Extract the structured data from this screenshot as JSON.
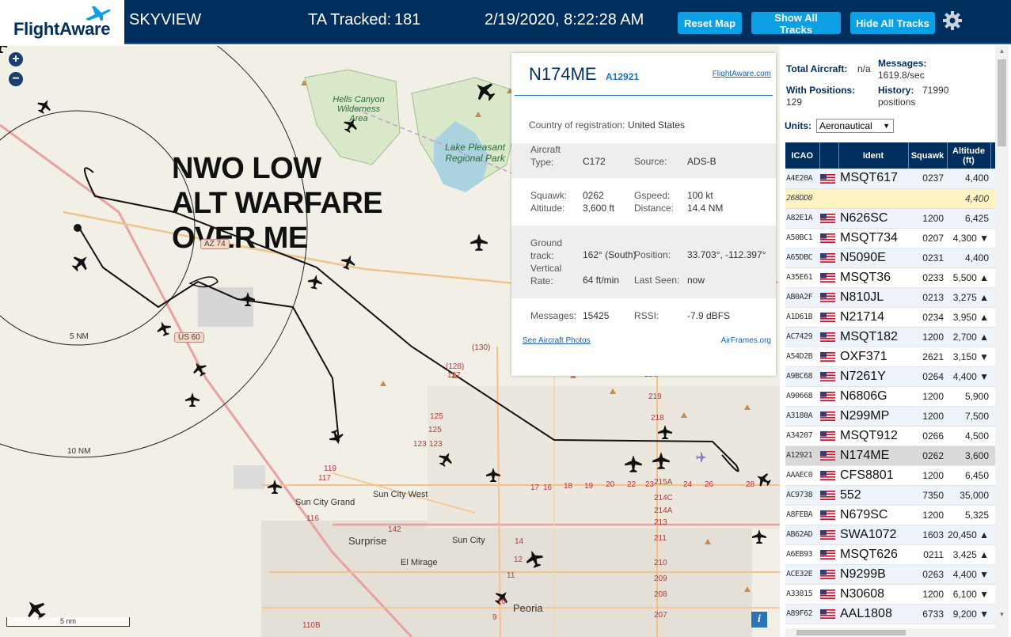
{
  "header": {
    "logo_text": "FlightAware",
    "app_title": "SKYVIEW",
    "ta_tracked_label": "TA Tracked:",
    "ta_tracked_count": "181",
    "datetime": "2/19/2020, 8:22:28 AM",
    "buttons": {
      "reset_map": "Reset Map",
      "show_all_tracks": "Show All Tracks",
      "hide_all_tracks": "Hide All Tracks"
    },
    "settings_icon": "gear-icon",
    "colors": {
      "bar": "#002f5d",
      "button": "#0d9fe3"
    }
  },
  "map": {
    "overlay_text": [
      "NWO LOW",
      "ALT WARFARE",
      "OVER ME"
    ],
    "zoom_in": "+",
    "zoom_out": "−",
    "scale_label": "5 nm",
    "range_rings": [
      "5 NM",
      "10 NM"
    ],
    "places": {
      "hells_canyon": "Hells Canyon Wilderness Area",
      "lake_pleasant": "Lake Pleasant Regional Park",
      "sun_city_grand": "Sun City Grand",
      "sun_city_west": "Sun City West",
      "surprise": "Surprise",
      "sun_city": "Sun City",
      "el_mirage": "El Mirage",
      "peoria": "Peoria"
    },
    "shields": {
      "az74": "AZ 74",
      "us60": "US 60"
    },
    "route_numbers": {
      "r130": "(130)",
      "r128": "(128)",
      "r127": "127",
      "r125": "125",
      "r125b": "125",
      "r123": "123",
      "r123b": "123",
      "r119": "119",
      "r117": "117",
      "r116": "116",
      "r142": "142",
      "r14": "14",
      "r12": "12",
      "r11": "11",
      "r10": "10",
      "r9": "9",
      "r110b": "110B",
      "r17": "17",
      "r16": "16",
      "r18": "18",
      "r19": "19",
      "r20": "20",
      "r22": "22",
      "r23": "23",
      "r24": "24",
      "r26": "26",
      "r28": "28",
      "r218": "218",
      "r219": "219",
      "r220": "220",
      "r215a": "215A",
      "r214c": "214C",
      "r214a": "214A",
      "r213": "213",
      "r211": "211",
      "r210": "210",
      "r209": "209",
      "r208": "208",
      "r207": "207"
    },
    "info_icon": "i"
  },
  "popup": {
    "callsign": "N174ME",
    "hex": "A12921",
    "fa_link": "FlightAware.com",
    "country_label": "Country of registration:",
    "country": "United States",
    "aircraft_type_label": "Aircraft Type:",
    "aircraft_type": "C172",
    "source_label": "Source:",
    "source": "ADS-B",
    "squawk_label": "Squawk:",
    "squawk": "0262",
    "gspeed_label": "Gspeed:",
    "gspeed": "100 kt",
    "altitude_label": "Altitude:",
    "altitude": "3,600 ft",
    "distance_label": "Distance:",
    "distance": "14.4 NM",
    "ground_track_label": "Ground track:",
    "ground_track": "162° (South)",
    "position_label": "Position:",
    "position": "33.703°, -112.397°",
    "vertical_rate_label": "Vertical Rate:",
    "vertical_rate": "64 ft/min",
    "last_seen_label": "Last Seen:",
    "last_seen": "now",
    "messages_label": "Messages:",
    "messages": "15425",
    "rssi_label": "RSSI:",
    "rssi": "-7.9 dBFS",
    "photos_link": "See Aircraft Photos",
    "airframes_link": "AirFrames.org"
  },
  "panel": {
    "total_aircraft_label": "Total Aircraft:",
    "total_aircraft": "n/a",
    "messages_label": "Messages:",
    "messages_rate": "1619.8/sec",
    "with_positions_label": "With Positions:",
    "with_positions": "129",
    "history_label": "History:",
    "history_value": "71990",
    "history_unit": "positions",
    "units_label": "Units:",
    "units_value": "Aeronautical",
    "columns": [
      "ICAO",
      "Ident",
      "Squawk",
      "Altitude (ft)"
    ],
    "rows": [
      {
        "icao": "A4E20A",
        "ident": "MSQT617",
        "squawk": "0237",
        "altitude": "4,400"
      },
      {
        "icao": "268DD0",
        "ident": "",
        "squawk": "",
        "altitude": "4,400"
      },
      {
        "icao": "A82E1A",
        "ident": "N626SC",
        "squawk": "1200",
        "altitude": "6,425"
      },
      {
        "icao": "A50BC1",
        "ident": "MSQT734",
        "squawk": "0207",
        "altitude": "4,300 ▼"
      },
      {
        "icao": "A65DBC",
        "ident": "N5090E",
        "squawk": "0231",
        "altitude": "4,400"
      },
      {
        "icao": "A35E61",
        "ident": "MSQT36",
        "squawk": "0233",
        "altitude": "5,500 ▲"
      },
      {
        "icao": "AB0A2F",
        "ident": "N810JL",
        "squawk": "0213",
        "altitude": "3,275 ▲"
      },
      {
        "icao": "A1D61B",
        "ident": "N21714",
        "squawk": "0234",
        "altitude": "3,950 ▲"
      },
      {
        "icao": "AC7429",
        "ident": "MSQT182",
        "squawk": "1200",
        "altitude": "2,700 ▲"
      },
      {
        "icao": "A54D2B",
        "ident": "OXF371",
        "squawk": "2621",
        "altitude": "3,150 ▼"
      },
      {
        "icao": "A9BC68",
        "ident": "N7261Y",
        "squawk": "0264",
        "altitude": "4,400 ▼"
      },
      {
        "icao": "A90668",
        "ident": "N6806G",
        "squawk": "1200",
        "altitude": "5,900"
      },
      {
        "icao": "A3180A",
        "ident": "N299MP",
        "squawk": "1200",
        "altitude": "7,500"
      },
      {
        "icao": "A34207",
        "ident": "MSQT912",
        "squawk": "0266",
        "altitude": "4,500"
      },
      {
        "icao": "A12921",
        "ident": "N174ME",
        "squawk": "0262",
        "altitude": "3,600"
      },
      {
        "icao": "AAAEC0",
        "ident": "CFS8801",
        "squawk": "1200",
        "altitude": "6,450"
      },
      {
        "icao": "AC9738",
        "ident": "552",
        "squawk": "7350",
        "altitude": "35,000"
      },
      {
        "icao": "A8FEBA",
        "ident": "N679SC",
        "squawk": "1200",
        "altitude": "5,325"
      },
      {
        "icao": "AB62AD",
        "ident": "SWA1072",
        "squawk": "1603",
        "altitude": "20,450 ▲"
      },
      {
        "icao": "A6EB93",
        "ident": "MSQT626",
        "squawk": "0211",
        "altitude": "3,425 ▲"
      },
      {
        "icao": "ACE32E",
        "ident": "N9299B",
        "squawk": "0263",
        "altitude": "4,400 ▼"
      },
      {
        "icao": "A33815",
        "ident": "N30608",
        "squawk": "1200",
        "altitude": "6,100 ▼"
      },
      {
        "icao": "A89F62",
        "ident": "AAL1808",
        "squawk": "6733",
        "altitude": "9,200 ▼"
      }
    ],
    "flag_icon": "us-flag-icon"
  }
}
